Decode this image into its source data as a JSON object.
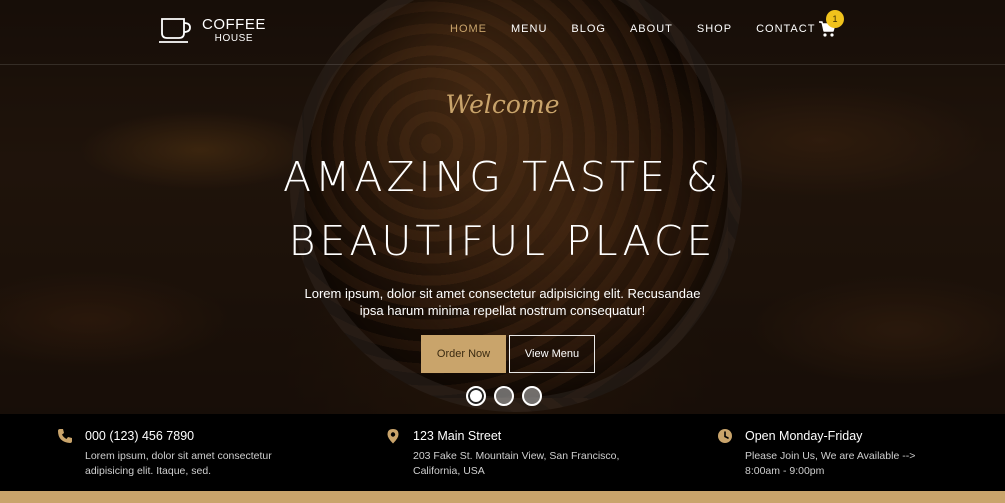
{
  "brand": {
    "title": "COFFEE",
    "subtitle": "HOUSE",
    "logo_icon": "coffee-cup-icon"
  },
  "nav": {
    "items": [
      {
        "label": "HOME",
        "active": true
      },
      {
        "label": "MENU",
        "active": false
      },
      {
        "label": "BLOG",
        "active": false
      },
      {
        "label": "ABOUT",
        "active": false
      },
      {
        "label": "SHOP",
        "active": false
      },
      {
        "label": "CONTACT",
        "active": false
      }
    ],
    "cart_icon": "cart-icon",
    "cart_count": "1"
  },
  "hero": {
    "welcome": "Welcome",
    "headline_line1": "AMAZING TASTE &",
    "headline_line2": "BEAUTIFUL PLACE",
    "lead_line1": "Lorem ipsum, dolor sit amet consectetur adipisicing elit. Recusandae",
    "lead_line2": "ipsa harum minima repellat nostrum consequatur!",
    "order_button": "Order Now",
    "menu_button": "View Menu",
    "slides": 3,
    "active_slide": 1
  },
  "info": {
    "phone": {
      "icon": "phone-icon",
      "title": "000 (123) 456 7890",
      "line1": "Lorem ipsum, dolor sit amet consectetur",
      "line2": "adipisicing elit. Itaque, sed."
    },
    "address": {
      "icon": "location-pin-icon",
      "title": "123 Main Street",
      "line1": "203 Fake St. Mountain View, San Francisco,",
      "line2": "California, USA"
    },
    "hours": {
      "icon": "clock-icon",
      "title": "Open Monday-Friday",
      "line1": "Please Join Us, We are Available -->",
      "line2": "8:00am - 9:00pm"
    }
  },
  "colors": {
    "accent": "#c9a46b",
    "badge": "#f0c21c",
    "info_bg": "#000000"
  }
}
